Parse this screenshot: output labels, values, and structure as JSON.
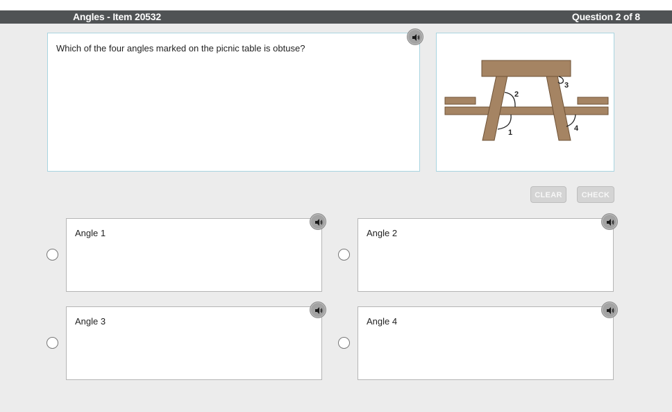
{
  "header": {
    "title": "Angles - Item 20532",
    "progress": "Question 2 of 8"
  },
  "question": {
    "text": "Which of the four angles marked on the picnic table is obtuse?",
    "audio_icon": "speaker-icon"
  },
  "figure": {
    "labels": [
      "1",
      "2",
      "3",
      "4"
    ],
    "colors": {
      "wood": "#a58463",
      "wood_edge": "#6e5236",
      "arc": "#222222"
    }
  },
  "buttons": {
    "clear": "CLEAR",
    "check": "CHECK"
  },
  "options": [
    {
      "label": "Angle 1"
    },
    {
      "label": "Angle 2"
    },
    {
      "label": "Angle 3"
    },
    {
      "label": "Angle 4"
    }
  ],
  "colors": {
    "header_bg": "#505355",
    "page_bg": "#ececec",
    "box_border": "#a8d4e0",
    "button_disabled": "#d4d4d4"
  }
}
